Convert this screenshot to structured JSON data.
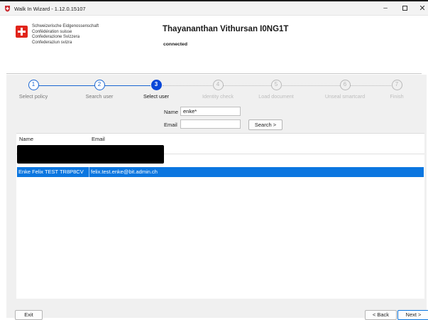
{
  "window": {
    "title": "Walk In Wizard - 1.12.0.15107",
    "minimize": "–",
    "close": "✕"
  },
  "header": {
    "confederation": [
      "Schweizerische Eidgenossenschaft",
      "Confédération suisse",
      "Confederazione Svizzera",
      "Confederaziun svizra"
    ],
    "user_name": "Thayananthan Vithursan I0NG1T",
    "status": "connected"
  },
  "steps": [
    {
      "number": "1",
      "label": "Select policy",
      "state": "done"
    },
    {
      "number": "2",
      "label": "Search user",
      "state": "done"
    },
    {
      "number": "3",
      "label": "Select user",
      "state": "active"
    },
    {
      "number": "4",
      "label": "Identity check",
      "state": "pending"
    },
    {
      "number": "5",
      "label": "Load document",
      "state": "pending"
    },
    {
      "number": "6",
      "label": "Unseal smartcard",
      "state": "pending"
    },
    {
      "number": "7",
      "label": "Finish",
      "state": "pending"
    }
  ],
  "search": {
    "name_label": "Name",
    "name_value": "enke*",
    "email_label": "Email",
    "email_value": "",
    "search_button": "Search >"
  },
  "results": {
    "columns": [
      "Name",
      "Email"
    ],
    "rows": [
      {
        "name": "Enke Felix TEST TR8P8CV",
        "email": "felix.test.enke@bit.admin.ch",
        "selected": true
      }
    ]
  },
  "footer": {
    "exit": "Exit",
    "back": "< Back",
    "next": "Next >"
  },
  "colors": {
    "accent": "#0a47d8",
    "selection": "#0b76e0",
    "swiss_red": "#e1251b"
  }
}
